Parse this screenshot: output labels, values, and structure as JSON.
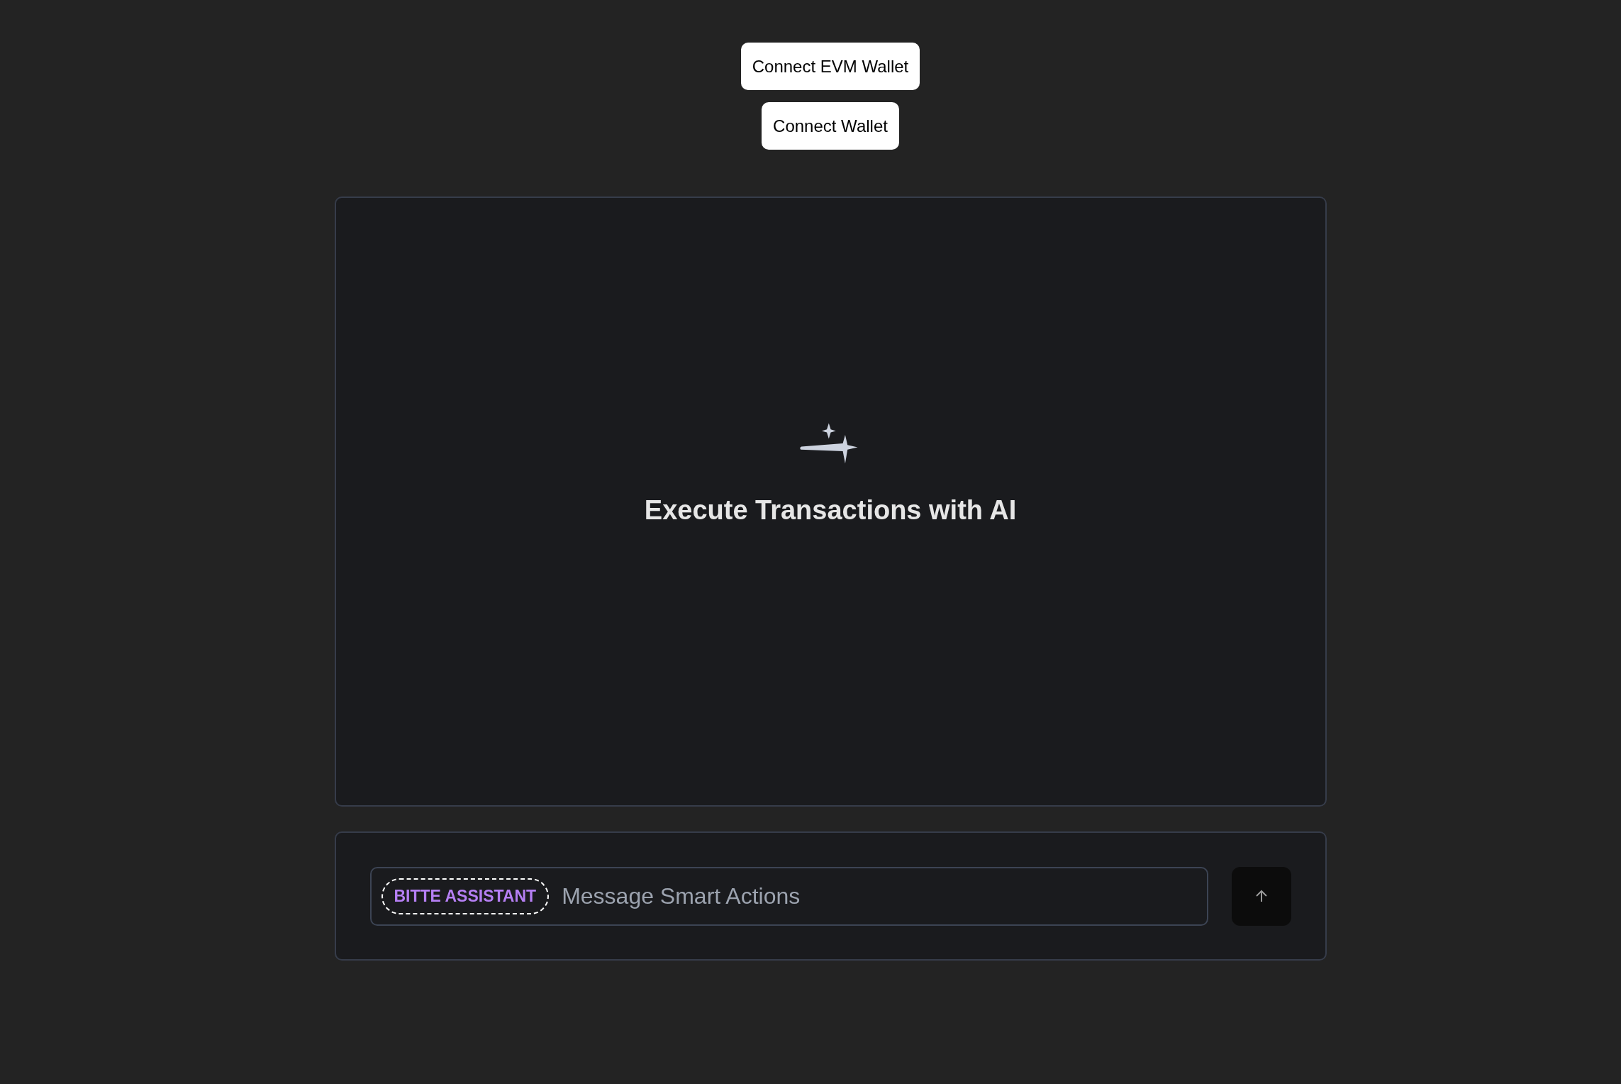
{
  "header_buttons": [
    "Connect EVM Wallet",
    "Connect Wallet"
  ],
  "chat": {
    "heading": "Execute Transactions with AI"
  },
  "composer": {
    "badge": "BITTE ASSISTANT",
    "placeholder": "Message Smart Actions"
  }
}
